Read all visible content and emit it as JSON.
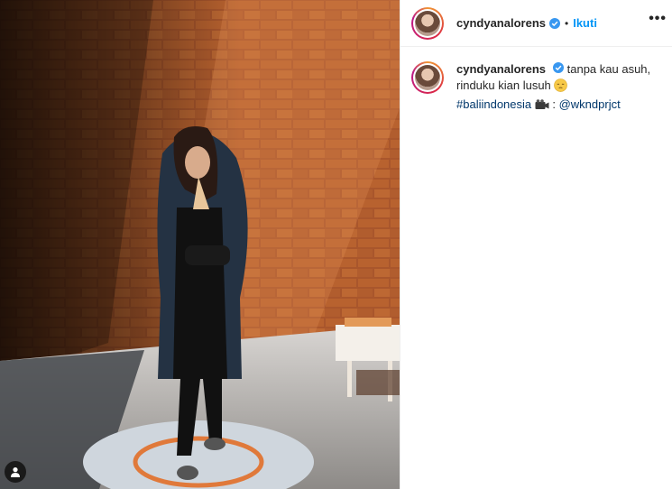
{
  "post": {
    "image_alt_icon": "tag-people-icon",
    "header": {
      "username": "cyndyanalorens",
      "separator": "•",
      "follow_label": "Ikuti",
      "more_label": "•••"
    },
    "caption": {
      "username": "cyndyanalorens",
      "line1": "tanpa kau asuh,",
      "line2": "rinduku kian lusuh",
      "emoji": "pensive-face-emoji",
      "hashtag": "#baliindonesia",
      "camera_emoji": "movie-camera-emoji",
      "separator": " : ",
      "mention": "@wkndprjct"
    },
    "colors": {
      "follow": "#0095f6",
      "link": "#00376b",
      "verified": "#3897f0"
    }
  }
}
